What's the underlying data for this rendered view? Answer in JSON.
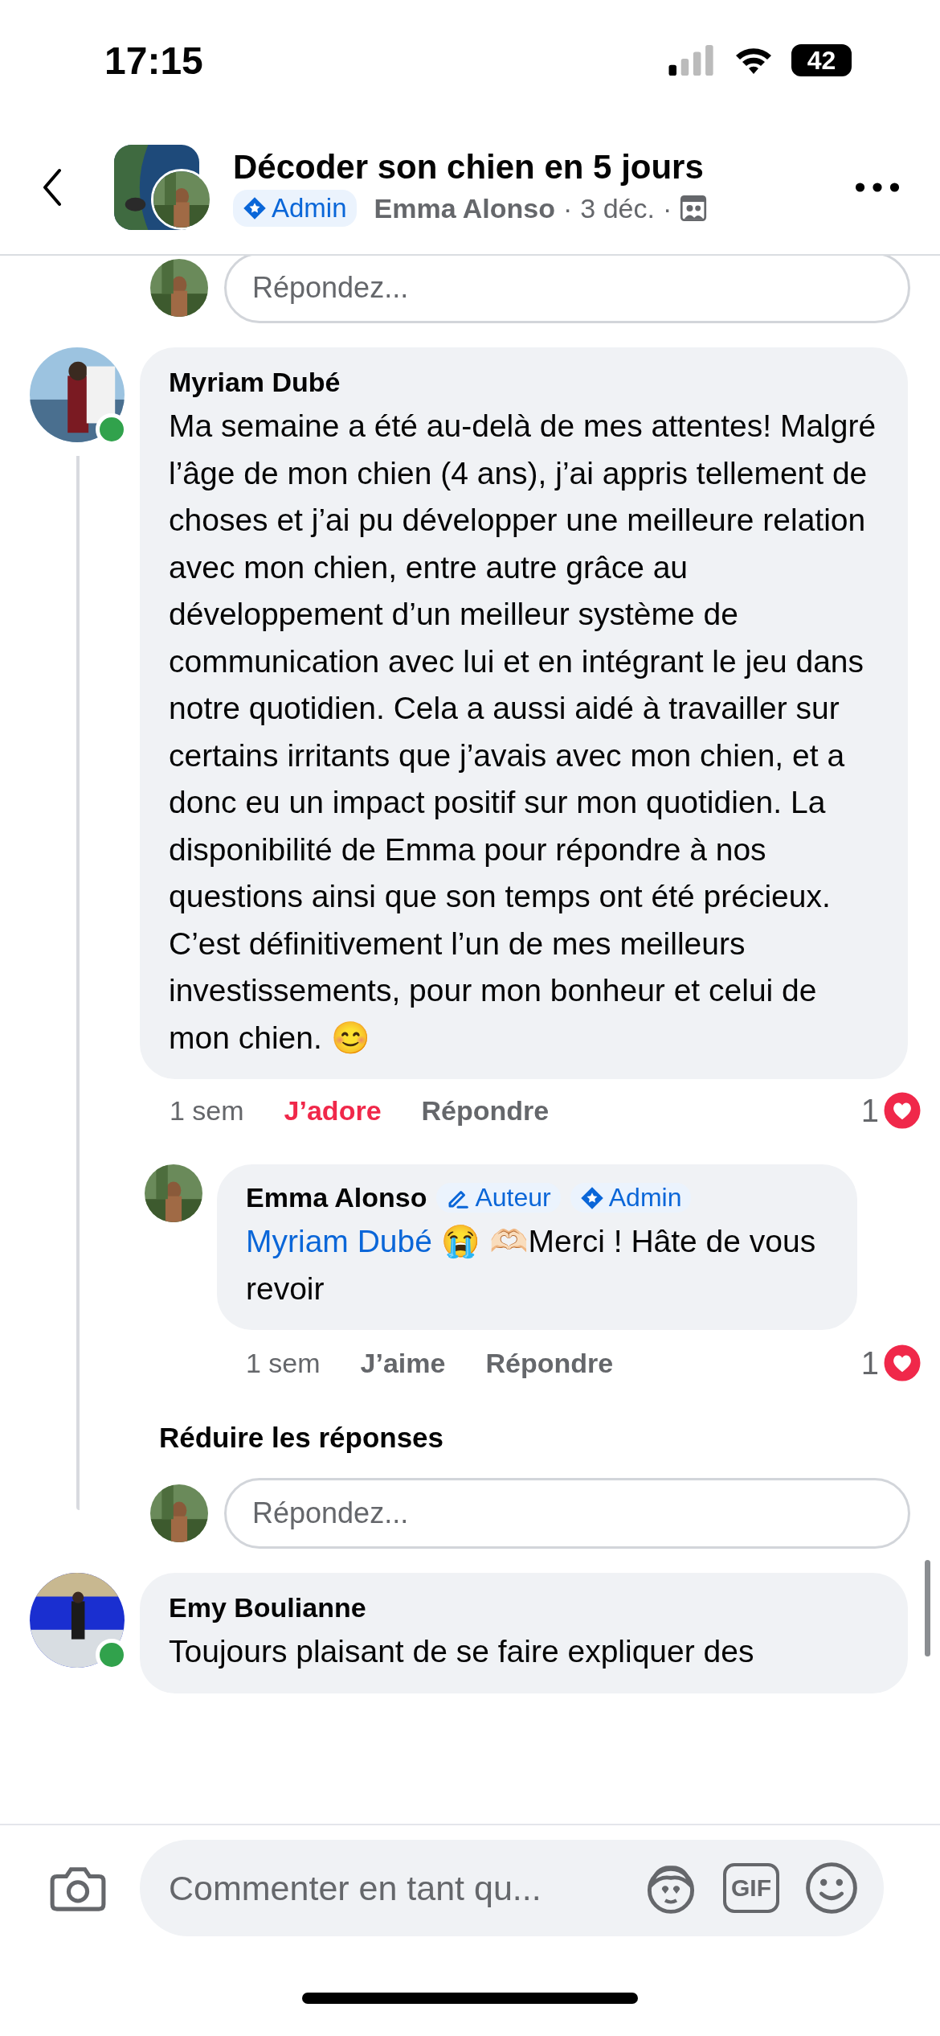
{
  "status_bar": {
    "time": "17:15",
    "battery": "42"
  },
  "header": {
    "title": "Décoder son chien en 5 jours",
    "badge": {
      "kind": "admin",
      "label": "Admin"
    },
    "author": "Emma Alonso",
    "separator_1": "·",
    "date": "3 déc.",
    "separator_2": "·"
  },
  "top_reply": {
    "placeholder": "Répondez..."
  },
  "comments": [
    {
      "author": "Myriam Dubé",
      "online": true,
      "text": "Ma semaine a été au-delà de mes attentes! Malgré l’âge de mon chien (4 ans), j’ai appris tellement de choses et j’ai pu développer une meilleure relation avec mon chien, entre autre grâce au développement d’un meilleur système de communication avec lui et en intégrant le jeu dans notre quotidien. Cela a aussi aidé à travailler sur certains irritants que j’avais avec mon chien, et a donc eu un impact positif sur mon quotidien. La disponibilité de Emma pour répondre à nos questions ainsi que son temps ont été précieux. C’est définitivement l’un de mes meilleurs investissements, pour mon bonheur et celui de mon chien. 😊",
      "time": "1 sem",
      "like_label": "J’adore",
      "liked": true,
      "reply_label": "Répondre",
      "reaction_count": "1",
      "replies": [
        {
          "author": "Emma Alonso",
          "badges": [
            {
              "kind": "author",
              "label": "Auteur"
            },
            {
              "kind": "admin",
              "label": "Admin"
            }
          ],
          "mention": "Myriam Dubé",
          "text": " 😭 🫶🏻Merci ! Hâte de vous revoir",
          "time": "1 sem",
          "like_label": "J’aime",
          "liked": false,
          "reply_label": "Répondre",
          "reaction_count": "1"
        }
      ],
      "collapse_label": "Réduire les réponses",
      "reply_placeholder": "Répondez..."
    },
    {
      "author": "Emy Boulianne",
      "online": true,
      "text": "Toujours plaisant de se faire expliquer des"
    }
  ],
  "composer": {
    "placeholder": "Commenter en tant qu...",
    "gif_label": "GIF"
  }
}
